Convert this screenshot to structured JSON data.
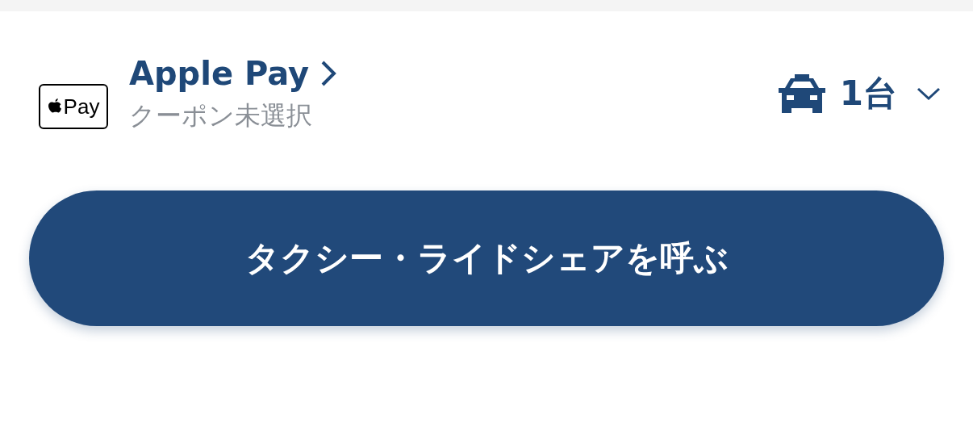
{
  "payment": {
    "badge_text": "Pay",
    "method": "Apple Pay",
    "coupon": "クーポン未選択"
  },
  "vehicles": {
    "count": "1台"
  },
  "call_button": {
    "label": "タクシー・ライドシェアを呼ぶ"
  }
}
